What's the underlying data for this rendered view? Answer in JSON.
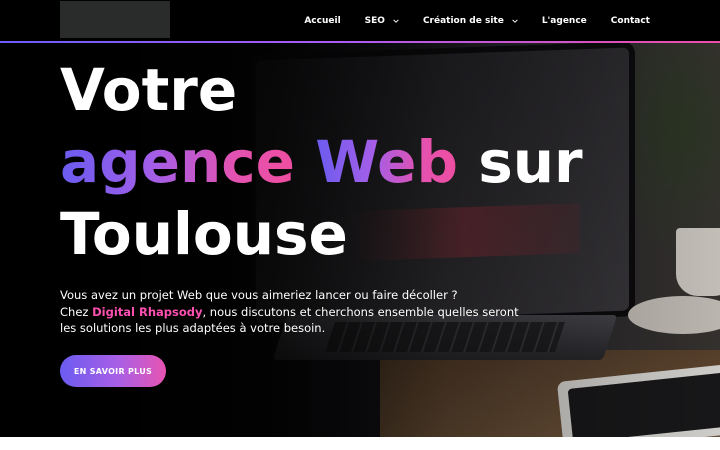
{
  "nav": {
    "items": [
      {
        "label": "Accueil",
        "dropdown": false
      },
      {
        "label": "SEO",
        "dropdown": true
      },
      {
        "label": "Création de site",
        "dropdown": true
      },
      {
        "label": "L'agence",
        "dropdown": false
      },
      {
        "label": "Contact",
        "dropdown": false
      }
    ]
  },
  "hero": {
    "title_line1": "Votre",
    "title_gradient_1": "agence",
    "title_gradient_2": "Web",
    "title_after": "sur",
    "title_line3": "Toulouse",
    "intro_line1": "Vous avez un projet Web que vous aimeriez lancer ou faire décoller ?",
    "intro_prefix": "Chez ",
    "intro_brand": "Digital Rhapsody",
    "intro_suffix": ", nous discutons et cherchons ensemble quelles seront les solutions les plus adaptées à votre besoin.",
    "cta_label": "EN SAVOIR PLUS"
  },
  "colors": {
    "accent_start": "#6b5cf2",
    "accent_mid": "#a95fe6",
    "accent_end": "#e754b2",
    "brand_text": "#ff4fb0"
  },
  "icons": {
    "dropdown": "chevron-down-icon"
  }
}
